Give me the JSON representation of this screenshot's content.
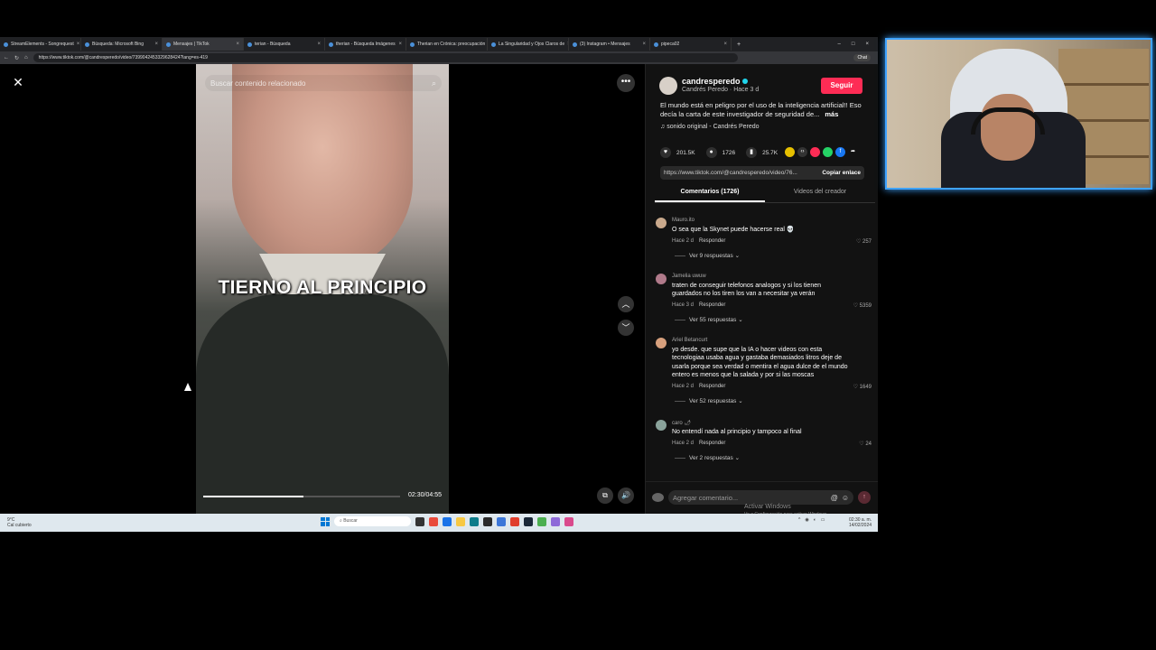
{
  "browser": {
    "tabs": [
      {
        "label": "StreamElements - Songrequest"
      },
      {
        "label": "Búsqueda: Microsoft Bing"
      },
      {
        "label": "Mensajes | TikTok"
      },
      {
        "label": "terian - Búsqueda"
      },
      {
        "label": "therian - Búsqueda Imágenes"
      },
      {
        "label": "Therian en Crónica: preocupación"
      },
      {
        "label": "La Singularidad y Ojos Claros de"
      },
      {
        "label": "(3) Instagram • Mensajes"
      },
      {
        "label": "pipeca02"
      }
    ],
    "active_tab_index": 2,
    "url": "https://www.tiktok.com/@candresperedo/video/7399042453329628424?lang=es-419",
    "chat_label": "Chat"
  },
  "video": {
    "search_placeholder": "Buscar contenido relacionado",
    "caption": "TIERNO AL PRINCIPIO",
    "time": "02:30/04:55",
    "progress": 0.51
  },
  "creator": {
    "username": "candresperedo",
    "subtitle": "Candrés Peredo · Hace 3 d",
    "follow_label": "Seguir",
    "description": "El mundo está en peligro por el uso de la inteligencia artificial!! Eso decía la carta de este investigador de seguridad de...",
    "more_label": "más",
    "sound": "sonido original - Candrés Peredo",
    "likes": "201.5K",
    "comments": "1726",
    "saves": "25.7K",
    "link": "https://www.tiktok.com/@candresperedo/video/76...",
    "copy_label": "Copiar enlace"
  },
  "tabs": {
    "comments_label": "Comentarios (1726)",
    "creator_label": "Videos del creador"
  },
  "comments": [
    {
      "user": "Mauro.ito",
      "text": "O sea que la Skynet puede hacerse real 💀",
      "meta": "Hace 2 d",
      "reply": "Responder",
      "likes": "257",
      "replies": "Ver 9 respuestas"
    },
    {
      "user": "Jamelia uwuw",
      "text": "traten de conseguir telefonos analogos y si los tienen guardados no los tiren los van a necesitar ya verán",
      "meta": "Hace 3 d",
      "reply": "Responder",
      "likes": "5359",
      "replies": "Ver 55 respuestas"
    },
    {
      "user": "Ariel Betancurt",
      "text": "yo desde. que supe que la IA o hacer videos con esta tecnologiaa usaba agua y gastaba demasiados litros deje de usarla porque sea verdad o mentira el agua dulce de el mundo entero es menos que la salada y por si las moscas",
      "meta": "Hace 2 d",
      "reply": "Responder",
      "likes": "1649",
      "replies": "Ver 52 respuestas"
    },
    {
      "user": "caro 🌶",
      "text": "No entendí nada al principio y tampoco al final",
      "meta": "Hace 2 d",
      "reply": "Responder",
      "likes": "24",
      "replies": "Ver 2 respuestas"
    }
  ],
  "add_comment": {
    "placeholder": "Agregar comentario..."
  },
  "watermark": {
    "line1": "Activar Windows",
    "line2": "Ve a Configuración para activar Windows."
  },
  "taskbar": {
    "weather_temp": "9°C",
    "weather_desc": "Cal cubierto",
    "search": "Buscar",
    "time": "02:30 a. m.",
    "date": "14/02/2024"
  },
  "colors": {
    "accent": "#fe2c55",
    "verified": "#20d5ec",
    "webcam_border": "#3fa3ff"
  }
}
